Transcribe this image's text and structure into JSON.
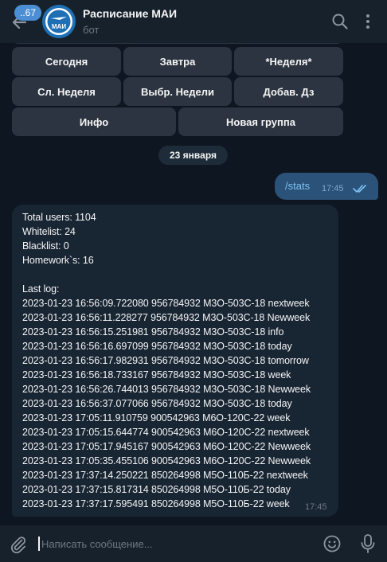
{
  "header": {
    "unread_count": "..67",
    "title": "Расписание МАИ",
    "subtitle": "бот",
    "avatar_text": "МАИ"
  },
  "keyboard": {
    "row1": [
      "Сегодня",
      "Завтра",
      "*Неделя*"
    ],
    "row2": [
      "Сл. Неделя",
      "Выбр. Недели",
      "Добав. Дз"
    ],
    "row3": [
      "Инфо",
      "Новая группа"
    ]
  },
  "date_separator": "23 января",
  "outgoing_message": {
    "text": "/stats",
    "time": "17:45"
  },
  "incoming_message": {
    "stats": [
      "Total users: 1104",
      "Whitelist: 24",
      "Blacklist: 0",
      "Homework`s: 16"
    ],
    "log_title": "Last log:",
    "log": [
      "2023-01-23 16:56:09.722080 956784932 М3О-503С-18 nextweek",
      "2023-01-23 16:56:11.228277 956784932 М3О-503С-18 Newweek",
      "2023-01-23 16:56:15.251981 956784932 М3О-503С-18 info",
      "2023-01-23 16:56:16.697099 956784932 М3О-503С-18 today",
      "2023-01-23 16:56:17.982931 956784932 М3О-503С-18 tomorrow",
      "2023-01-23 16:56:18.733167 956784932 М3О-503С-18 week",
      "2023-01-23 16:56:26.744013 956784932 М3О-503С-18 Newweek",
      "2023-01-23 16:56:37.077066 956784932 М3О-503С-18 today",
      "2023-01-23 17:05:11.910759 900542963 М6О-120С-22 week",
      "2023-01-23 17:05:15.644774 900542963 М6О-120С-22 nextweek",
      "2023-01-23 17:05:17.945167 900542963 М6О-120С-22 Newweek",
      "2023-01-23 17:05:35.455106 900542963 М6О-120С-22 Newweek",
      "2023-01-23 17:37:14.250221 850264998 М5О-110Б-22 nextweek",
      "2023-01-23 17:37:15.817314 850264998 М5О-110Б-22 today",
      "2023-01-23 17:37:17.595491 850264998 М5О-110Б-22 week"
    ],
    "time": "17:45"
  },
  "composer": {
    "placeholder": "Написать сообщение..."
  },
  "colors": {
    "background": "#0e1621",
    "header": "#17212b",
    "button": "#2b3440",
    "outgoing_bubble": "#2b5278",
    "incoming_bubble": "#182533",
    "accent": "#4b8ed4"
  }
}
